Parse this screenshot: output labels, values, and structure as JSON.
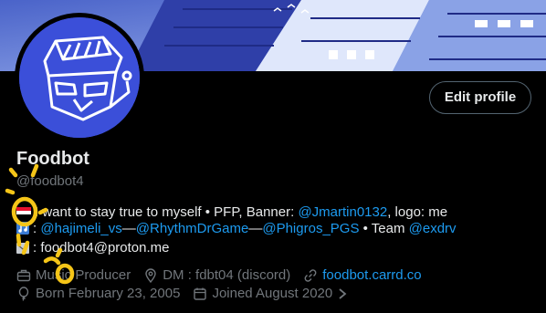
{
  "profile": {
    "name": "Foodbot",
    "handle": "@foodbot4",
    "edit_label": "Edit profile"
  },
  "bio": {
    "line1_text": "I want to stay true to myself • PFP, Banner: ",
    "line1_link": "@Jmartin0132",
    "line1_suffix": ", logo: me",
    "line2_prefix": ": ",
    "line2_link1": "@hajimeli_vs",
    "line2_dash1": "—",
    "line2_link2": "@RhythmDrGame",
    "line2_dash2": "—",
    "line2_link3": "@Phigros_PGS",
    "line2_team": " • Team ",
    "line2_link4": "@exdrv",
    "line3_text": ": foodbot4@proton.me"
  },
  "meta": {
    "profession": "Music Producer",
    "location": "DM : fdbt04 (discord)",
    "website": "foodbot.carrd.co",
    "birthday": "Born February 23, 2005",
    "joined": "Joined August 2020"
  },
  "colors": {
    "accent": "#1d9bf0",
    "muted": "#71767b",
    "annotation": "#f5c518"
  }
}
